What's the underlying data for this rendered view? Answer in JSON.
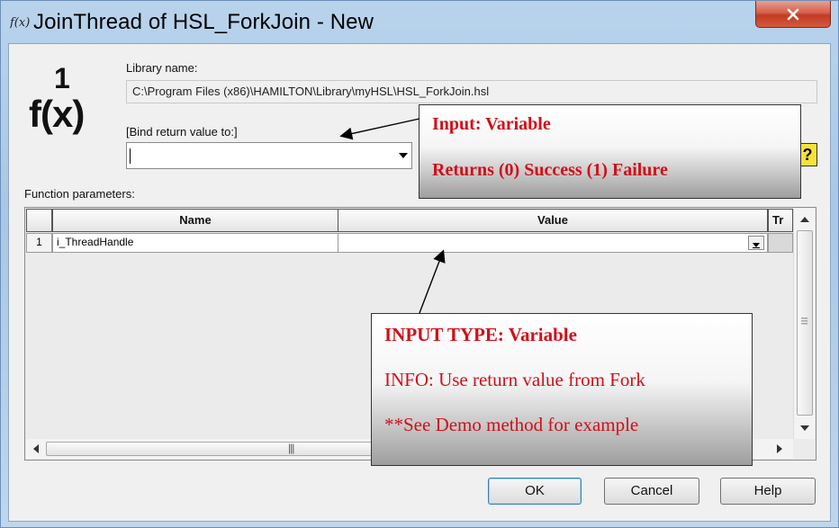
{
  "window": {
    "title": "JoinThread of HSL_ForkJoin - New",
    "icon": "function-icon",
    "close_icon": "close-icon"
  },
  "logo": {
    "one": "1",
    "fx": "f(x)"
  },
  "library": {
    "label": "Library name:",
    "value": "C:\\Program Files (x86)\\HAMILTON\\Library\\myHSL\\HSL_ForkJoin.hsl"
  },
  "bind": {
    "label": "[Bind return value to:]",
    "value": ""
  },
  "help_icon": "?",
  "params": {
    "label": "Function parameters:",
    "columns": [
      "Name",
      "Value",
      "Tr"
    ],
    "rows": [
      {
        "num": "1",
        "name": "i_ThreadHandle",
        "value": ""
      }
    ]
  },
  "buttons": {
    "ok": "OK",
    "cancel": "Cancel",
    "help": "Help"
  },
  "annotations": {
    "top": {
      "line1": "Input: Variable",
      "line2": "Returns (0) Success (1) Failure"
    },
    "bottom": {
      "line1": "INPUT TYPE: Variable",
      "line2": "INFO: Use return value from Fork",
      "line3": "**See Demo method for example"
    },
    "text_color": "#d0101a"
  },
  "colors": {
    "close_button": "#c33b22",
    "window_frame": "#a9c7e6",
    "ok_focus": "#3c7fb1"
  }
}
